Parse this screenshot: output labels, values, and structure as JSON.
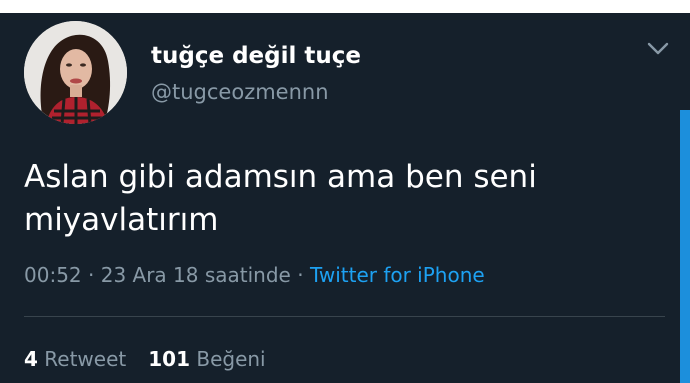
{
  "user": {
    "display_name": "tuğçe değil tuçe",
    "handle": "@tugceozmennn",
    "avatar_icon": "profile-photo"
  },
  "tweet": {
    "text_line1": "Aslan gibi adamsın ama ben seni",
    "text_line2": "miyavlatırım"
  },
  "meta": {
    "time": "00:52",
    "separator1": " · ",
    "date_text": "23 Ara 18 saatinde",
    "separator2": " · ",
    "source": "Twitter for iPhone"
  },
  "stats": {
    "retweet_count": "4",
    "retweet_label": "Retweet",
    "like_count": "101",
    "like_label": "Beğeni"
  },
  "colors": {
    "background": "#15202b",
    "link": "#1da1f2",
    "secondary_text": "#8899a6"
  },
  "icons": {
    "menu": "chevron-down-icon"
  }
}
